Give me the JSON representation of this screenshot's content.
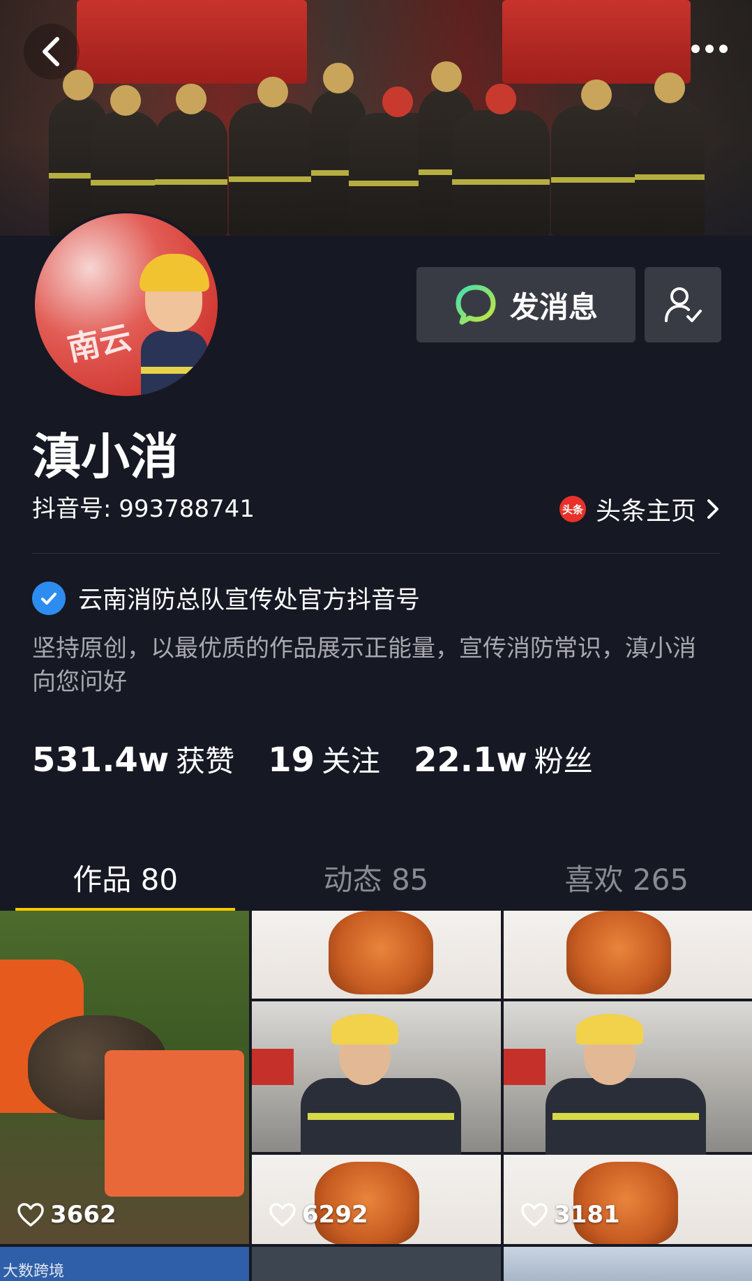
{
  "header": {
    "back_icon": "chevron-left-icon",
    "more_icon": "more-dots-icon"
  },
  "actions": {
    "message_label": "发消息",
    "message_icon": "chat-bubble-icon",
    "follow_icon": "user-check-icon"
  },
  "profile": {
    "nickname": "滇小消",
    "douyin_id": "抖音号: 993788741",
    "toutiao_badge": "头条",
    "toutiao_label": "头条主页",
    "verification": "云南消防总队宣传处官方抖音号",
    "bio": "坚持原创，以最优质的作品展示正能量，宣传消防常识，滇小消向您问好",
    "avatar_sign": "南云"
  },
  "stats": [
    {
      "value": "531.4w",
      "label": "获赞"
    },
    {
      "value": "19",
      "label": "关注"
    },
    {
      "value": "22.1w",
      "label": "粉丝"
    }
  ],
  "tabs": [
    {
      "label": "作品 80",
      "active": true
    },
    {
      "label": "动态 85",
      "active": false
    },
    {
      "label": "喜欢 265",
      "active": false
    }
  ],
  "videos": [
    {
      "likes": "3662"
    },
    {
      "likes": "6292"
    },
    {
      "likes": "3181"
    }
  ],
  "watermark": "大数跨境",
  "colors": {
    "background": "#161823",
    "button": "#393b44",
    "tab_indicator": "#f7c800",
    "verify_blue": "#2d8cf0",
    "toutiao_red": "#e8312a"
  }
}
